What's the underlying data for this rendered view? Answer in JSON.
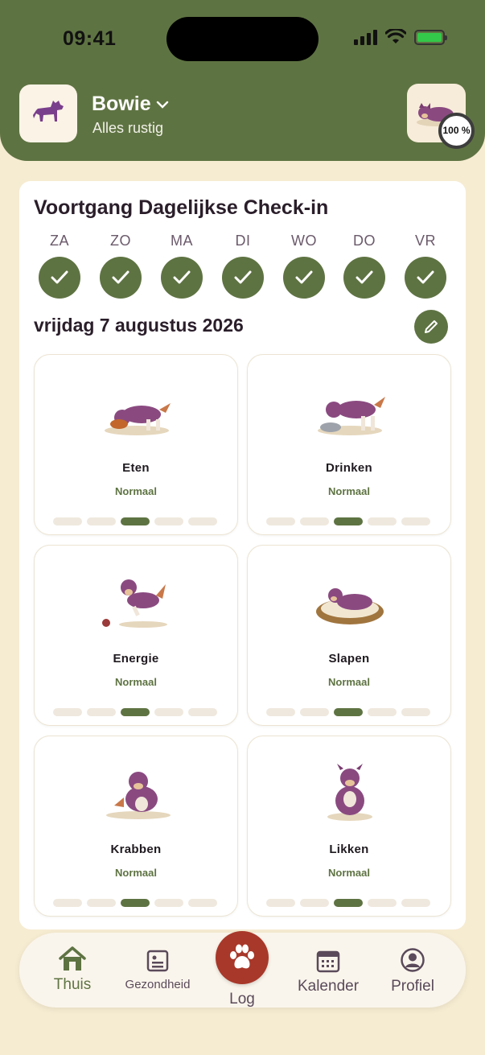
{
  "status_bar": {
    "time": "09:41"
  },
  "header": {
    "pet_name": "Bowie",
    "pet_status": "Alles rustig",
    "completion": "100 %"
  },
  "checkin": {
    "title": "Voortgang Dagelijkse Check-in",
    "days": [
      "ZA",
      "ZO",
      "MA",
      "DI",
      "WO",
      "DO",
      "VR"
    ],
    "date": "vrijdag 7 augustus 2026"
  },
  "tiles": [
    {
      "name": "Eten",
      "value": "Normaal",
      "level": 3,
      "scale_max": 5
    },
    {
      "name": "Drinken",
      "value": "Normaal",
      "level": 3,
      "scale_max": 5
    },
    {
      "name": "Energie",
      "value": "Normaal",
      "level": 3,
      "scale_max": 5
    },
    {
      "name": "Slapen",
      "value": "Normaal",
      "level": 3,
      "scale_max": 5
    },
    {
      "name": "Krabben",
      "value": "Normaal",
      "level": 3,
      "scale_max": 5
    },
    {
      "name": "Likken",
      "value": "Normaal",
      "level": 3,
      "scale_max": 5
    }
  ],
  "tabbar": {
    "home": "Thuis",
    "health": "Gezondheid",
    "log": "Log",
    "calendar": "Kalender",
    "profile": "Profiel"
  },
  "colors": {
    "header": "#5e7342",
    "accent": "#5e7342",
    "log": "#a8382a",
    "background": "#f6ecd2"
  }
}
